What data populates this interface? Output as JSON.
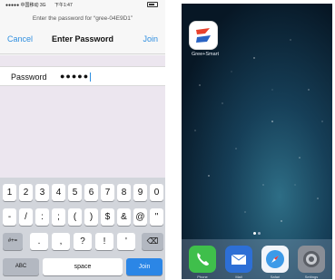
{
  "left_screen": {
    "status_bar": {
      "carrier": "●●●●● 中国移动 3G",
      "time": "下午1:47"
    },
    "prompt": "Enter the password for “gree-04E9D1”",
    "nav": {
      "cancel_label": "Cancel",
      "title": "Enter Password",
      "join_label": "Join"
    },
    "password": {
      "label": "Password",
      "value": "●●●●●"
    },
    "keyboard": {
      "row1": [
        "1",
        "2",
        "3",
        "4",
        "5",
        "6",
        "7",
        "8",
        "9",
        "0"
      ],
      "row2": [
        "-",
        "/",
        ":",
        ";",
        "(",
        ")",
        "$",
        "&",
        "@",
        "\""
      ],
      "row3_left": "#+=",
      "row3": [
        ".",
        ",",
        "?",
        "!",
        "'"
      ],
      "row3_right": "⌫",
      "row4": {
        "abc": "ABC",
        "space": "space",
        "join": "Join"
      }
    }
  },
  "right_screen": {
    "app": {
      "label": "Gree+Smart"
    },
    "dock": [
      {
        "icon": "phone-icon",
        "label": "Phone",
        "color": "#3fbf4b"
      },
      {
        "icon": "mail-icon",
        "label": "Mail",
        "color": "#2d6fd6"
      },
      {
        "icon": "safari-icon",
        "label": "Safari",
        "color": "#f2f5fa"
      },
      {
        "icon": "settings-icon",
        "label": "Settings",
        "color": "#8a8e96"
      }
    ]
  },
  "colors": {
    "accent": "#2f8fe0",
    "form_bg": "#ece6ef",
    "keyboard_bg": "#d2d5db",
    "wallpaper_dark": "#0c2a3d"
  }
}
